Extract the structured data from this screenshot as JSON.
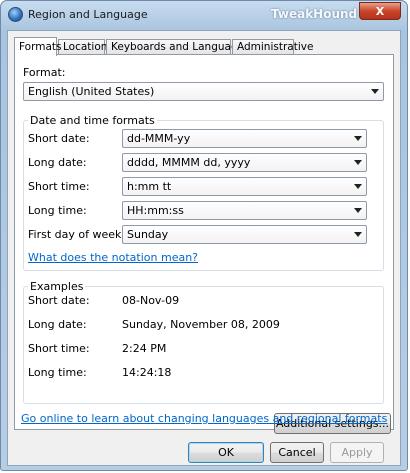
{
  "window": {
    "title": "Region and Language",
    "watermark": "TweakHound",
    "close_glyph": "X"
  },
  "tabs": [
    {
      "label": "Formats",
      "active": true
    },
    {
      "label": "Location",
      "active": false
    },
    {
      "label": "Keyboards and Languages",
      "active": false
    },
    {
      "label": "Administrative",
      "active": false
    }
  ],
  "format": {
    "label": "Format:",
    "value": "English (United States)"
  },
  "datetime": {
    "title": "Date and time formats",
    "rows": [
      {
        "label": "Short date:",
        "value": "dd-MMM-yy"
      },
      {
        "label": "Long date:",
        "value": "dddd, MMMM dd, yyyy"
      },
      {
        "label": "Short time:",
        "value": "h:mm tt"
      },
      {
        "label": "Long time:",
        "value": "HH:mm:ss"
      },
      {
        "label": "First day of week:",
        "value": "Sunday"
      }
    ],
    "notation_link": "What does the notation mean?"
  },
  "examples": {
    "title": "Examples",
    "rows": [
      {
        "label": "Short date:",
        "value": "08-Nov-09"
      },
      {
        "label": "Long date:",
        "value": "Sunday, November 08, 2009"
      },
      {
        "label": "Short time:",
        "value": "2:24 PM"
      },
      {
        "label": "Long time:",
        "value": "14:24:18"
      }
    ]
  },
  "additional_settings_label": "Additional settings...",
  "online_link": "Go online to learn about changing languages and regional formats",
  "buttons": {
    "ok": "OK",
    "cancel": "Cancel",
    "apply": "Apply"
  }
}
